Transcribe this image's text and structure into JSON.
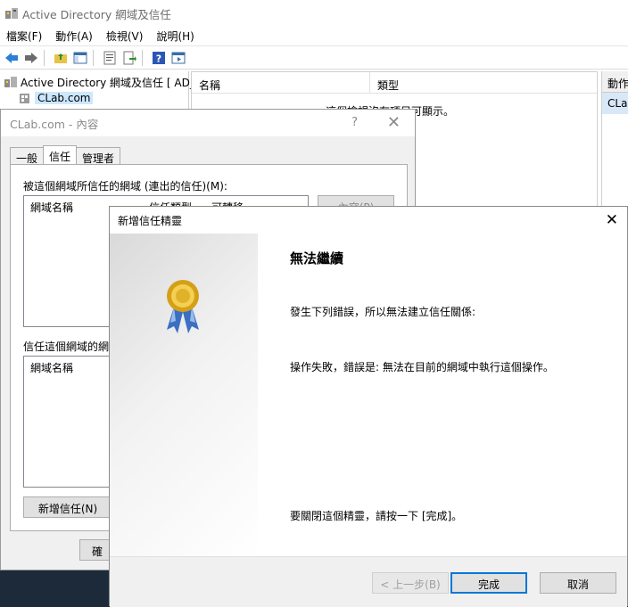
{
  "window": {
    "title": "Active Directory 網域及信任"
  },
  "menu": [
    "檔案(F)",
    "動作(A)",
    "檢視(V)",
    "說明(H)"
  ],
  "tree": {
    "root": "Active Directory 網域及信任 [ AD_C",
    "child": "CLab.com"
  },
  "list": {
    "col_name": "名稱",
    "col_type": "類型",
    "empty": "這個檢視沒有項目可顯示。"
  },
  "actions": {
    "header": "動作",
    "selected": "CLab"
  },
  "props": {
    "title": "CLab.com - 內容",
    "help": "?",
    "tabs": [
      "一般",
      "信任",
      "管理者"
    ],
    "outgoing_label": "被這個網域所信任的網域 (連出的信任)(M):",
    "col_domain": "網域名稱",
    "col_trust_type": "信任類型",
    "col_transitive": "可轉移",
    "properties_btn": "內容(P)",
    "incoming_label": "信任這個網域的網",
    "col_domain2": "網域名稱",
    "new_trust_btn": "新增信任(N)",
    "ok_btn": "確"
  },
  "wizard": {
    "title": "新增信任精靈",
    "heading": "無法繼續",
    "line1": "發生下列錯誤，所以無法建立信任關係:",
    "line2": "操作失敗，錯誤是: 無法在目前的網域中執行這個操作。",
    "line3": "要關閉這個精靈，請按一下 [完成]。",
    "back_btn": "< 上一步(B)",
    "finish_btn": "完成",
    "cancel_btn": "取消"
  }
}
